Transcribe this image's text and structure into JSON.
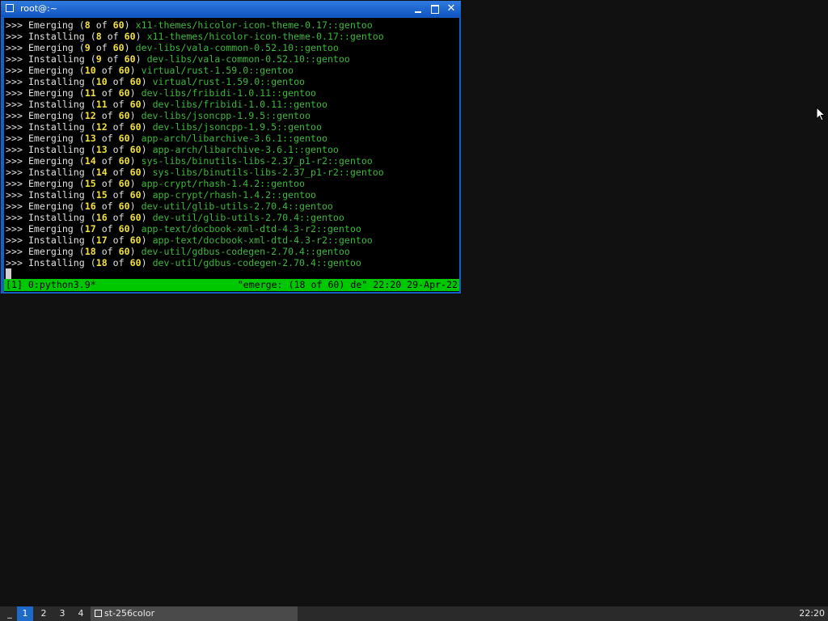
{
  "window": {
    "title": "root@:~",
    "buttons": {
      "minimize": "_",
      "maximize": "□",
      "close": "✕"
    }
  },
  "terminal": {
    "prefix": ">>>",
    "lines": [
      {
        "action": "Emerging",
        "n": "8",
        "of": "of",
        "total": "60",
        "pkg": "x11-themes/hicolor-icon-theme-0.17::gentoo"
      },
      {
        "action": "Installing",
        "n": "8",
        "of": "of",
        "total": "60",
        "pkg": "x11-themes/hicolor-icon-theme-0.17::gentoo"
      },
      {
        "action": "Emerging",
        "n": "9",
        "of": "of",
        "total": "60",
        "pkg": "dev-libs/vala-common-0.52.10::gentoo"
      },
      {
        "action": "Installing",
        "n": "9",
        "of": "of",
        "total": "60",
        "pkg": "dev-libs/vala-common-0.52.10::gentoo"
      },
      {
        "action": "Emerging",
        "n": "10",
        "of": "of",
        "total": "60",
        "pkg": "virtual/rust-1.59.0::gentoo"
      },
      {
        "action": "Installing",
        "n": "10",
        "of": "of",
        "total": "60",
        "pkg": "virtual/rust-1.59.0::gentoo"
      },
      {
        "action": "Emerging",
        "n": "11",
        "of": "of",
        "total": "60",
        "pkg": "dev-libs/fribidi-1.0.11::gentoo"
      },
      {
        "action": "Installing",
        "n": "11",
        "of": "of",
        "total": "60",
        "pkg": "dev-libs/fribidi-1.0.11::gentoo"
      },
      {
        "action": "Emerging",
        "n": "12",
        "of": "of",
        "total": "60",
        "pkg": "dev-libs/jsoncpp-1.9.5::gentoo"
      },
      {
        "action": "Installing",
        "n": "12",
        "of": "of",
        "total": "60",
        "pkg": "dev-libs/jsoncpp-1.9.5::gentoo"
      },
      {
        "action": "Emerging",
        "n": "13",
        "of": "of",
        "total": "60",
        "pkg": "app-arch/libarchive-3.6.1::gentoo"
      },
      {
        "action": "Installing",
        "n": "13",
        "of": "of",
        "total": "60",
        "pkg": "app-arch/libarchive-3.6.1::gentoo"
      },
      {
        "action": "Emerging",
        "n": "14",
        "of": "of",
        "total": "60",
        "pkg": "sys-libs/binutils-libs-2.37_p1-r2::gentoo"
      },
      {
        "action": "Installing",
        "n": "14",
        "of": "of",
        "total": "60",
        "pkg": "sys-libs/binutils-libs-2.37_p1-r2::gentoo"
      },
      {
        "action": "Emerging",
        "n": "15",
        "of": "of",
        "total": "60",
        "pkg": "app-crypt/rhash-1.4.2::gentoo"
      },
      {
        "action": "Installing",
        "n": "15",
        "of": "of",
        "total": "60",
        "pkg": "app-crypt/rhash-1.4.2::gentoo"
      },
      {
        "action": "Emerging",
        "n": "16",
        "of": "of",
        "total": "60",
        "pkg": "dev-util/glib-utils-2.70.4::gentoo"
      },
      {
        "action": "Installing",
        "n": "16",
        "of": "of",
        "total": "60",
        "pkg": "dev-util/glib-utils-2.70.4::gentoo"
      },
      {
        "action": "Emerging",
        "n": "17",
        "of": "of",
        "total": "60",
        "pkg": "app-text/docbook-xml-dtd-4.3-r2::gentoo"
      },
      {
        "action": "Installing",
        "n": "17",
        "of": "of",
        "total": "60",
        "pkg": "app-text/docbook-xml-dtd-4.3-r2::gentoo"
      },
      {
        "action": "Emerging",
        "n": "18",
        "of": "of",
        "total": "60",
        "pkg": "dev-util/gdbus-codegen-2.70.4::gentoo"
      },
      {
        "action": "Installing",
        "n": "18",
        "of": "of",
        "total": "60",
        "pkg": "dev-util/gdbus-codegen-2.70.4::gentoo"
      }
    ],
    "status_left": "[1] 0:python3.9*",
    "status_right": "\"emerge: (18 of 60) de\" 22:20 29-Apr-22"
  },
  "taskbar": {
    "minimize_symbol": "_",
    "workspaces": [
      "1",
      "2",
      "3",
      "4"
    ],
    "active_workspace": "1",
    "task_label": "st-256color",
    "clock": "22:20"
  },
  "colors": {
    "desktop": "#111111",
    "titlebar": "#1560c8",
    "status_green": "#00c800",
    "number_yellow": "#f0e040",
    "package_green": "#3cb83c"
  }
}
